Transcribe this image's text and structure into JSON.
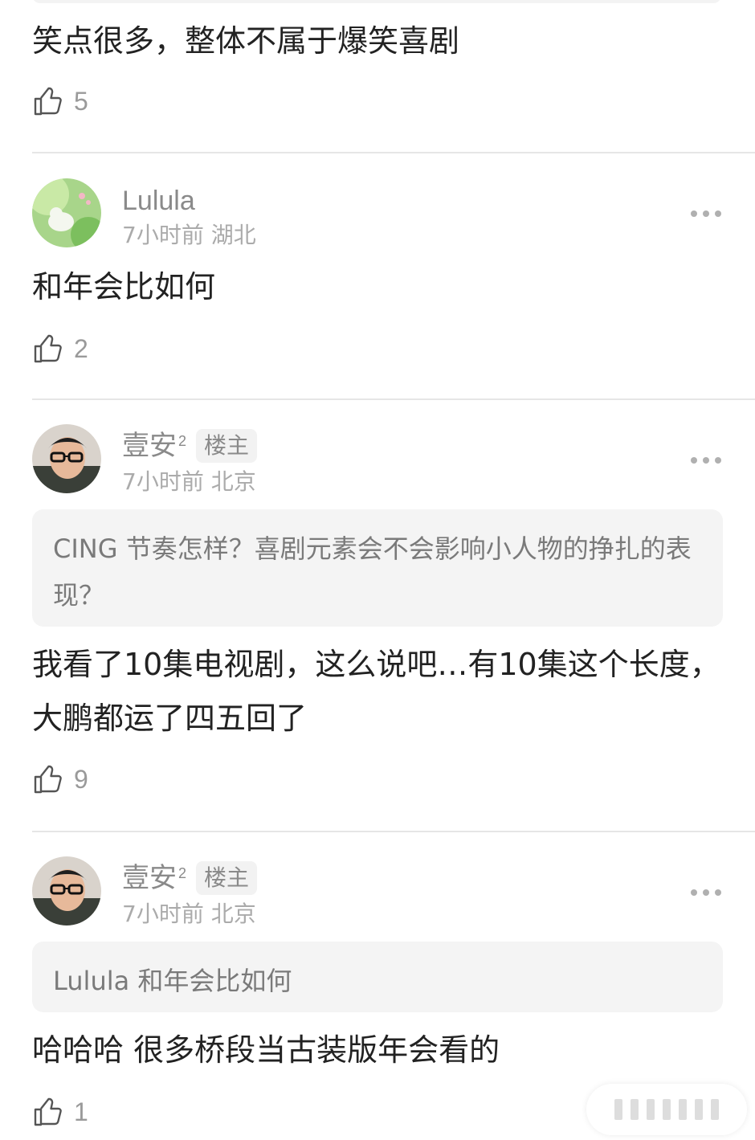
{
  "comments": [
    {
      "text": "笑点很多，整体不属于爆笑喜剧",
      "likes": "5"
    },
    {
      "user": "Lulula",
      "time": "7小时前",
      "location": "湖北",
      "text": "和年会比如何",
      "likes": "2"
    },
    {
      "user": "壹安",
      "user_sup": "2",
      "badge": "楼主",
      "time": "7小时前",
      "location": "北京",
      "quote": "CING 节奏怎样？喜剧元素会不会影响小人物的挣扎的表现？",
      "text": "我看了10集电视剧，这么说吧…有10集这个长度，大鹏都运了四五回了",
      "likes": "9"
    },
    {
      "user": "壹安",
      "user_sup": "2",
      "badge": "楼主",
      "time": "7小时前",
      "location": "北京",
      "quote": "Lulula 和年会比如何",
      "text": "哈哈哈 很多桥段当古装版年会看的",
      "likes": "1"
    }
  ],
  "icons": {
    "like": "thumbs-up-icon",
    "more": "more-dots-icon"
  },
  "colors": {
    "text": "#222222",
    "muted": "#8a8a8a",
    "divider": "#e6e6e6",
    "quote_bg": "#f4f4f4"
  }
}
